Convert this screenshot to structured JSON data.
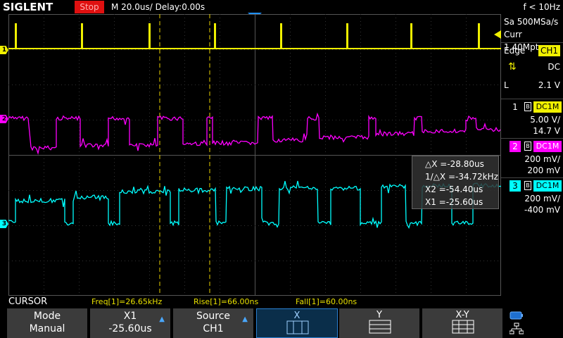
{
  "header": {
    "brand": "SIGLENT",
    "run_state": "Stop",
    "timebase": "M 20.0us/",
    "delay": "Delay:0.00s",
    "trigger_freq": "f < 10Hz"
  },
  "acquisition": {
    "sample_rate": "Sa 500MSa/s",
    "memory_depth": "Curr 1.40Mpts"
  },
  "trigger": {
    "type": "Edge",
    "source": "CH1",
    "slope_icon": "edge-both-icon",
    "coupling": "DC",
    "level_label": "L",
    "level": "2.1 V"
  },
  "channels": [
    {
      "num": "1",
      "coupling": "DC1M",
      "scale": "5.00 V/",
      "offset": "14.7 V",
      "color": "#f0f000"
    },
    {
      "num": "2",
      "coupling": "DC1M",
      "scale": "200 mV/",
      "offset": "200 mV",
      "color": "#ff00ff"
    },
    {
      "num": "3",
      "coupling": "DC1M",
      "scale": "200 mV/",
      "offset": "-400 mV",
      "color": "#00ffff"
    }
  ],
  "cursor_readout": {
    "delta_x": "△X =-28.80us",
    "inv_delta_x": "1/△X =-34.72kHz",
    "x2": "X2 =-54.40us",
    "x1": "X1 =-25.60us"
  },
  "info": {
    "mode_title": "CURSOR",
    "freq": "Freq[1]=26.65kHz",
    "rise": "Rise[1]=66.00ns",
    "fall": "Fall[1]=60.00ns"
  },
  "menu": {
    "mode_label": "Mode",
    "mode_value": "Manual",
    "x1_label": "X1",
    "x1_value": "-25.60us",
    "source_label": "Source",
    "source_value": "CH1",
    "x_label": "X",
    "y_label": "Y",
    "xy_label": "X-Y"
  },
  "colors": {
    "ch1": "#f0f000",
    "ch2": "#ff00ff",
    "ch3": "#00ffff",
    "stop_badge": "#e01010",
    "cursor_line": "#e8d000",
    "menu_accent": "#4aa8ff"
  }
}
